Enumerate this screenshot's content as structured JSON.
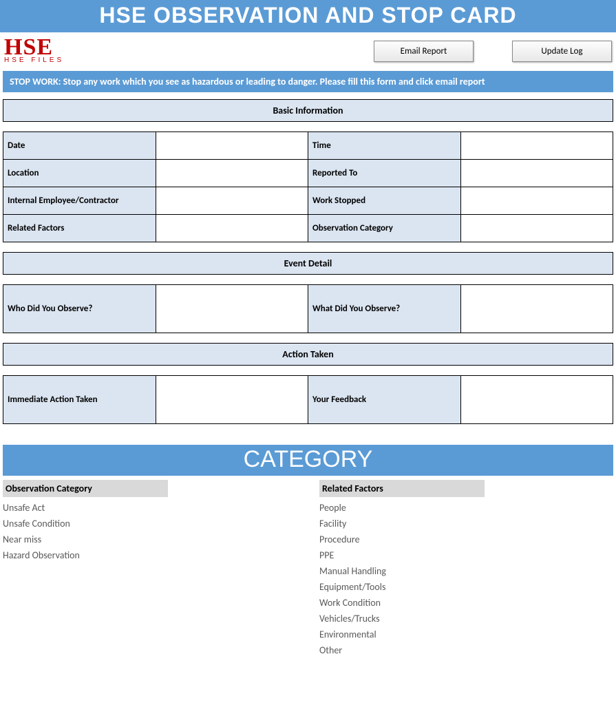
{
  "title": "HSE OBSERVATION AND STOP CARD",
  "logo": {
    "big": "HSE",
    "small": "HSE FILES"
  },
  "buttons": {
    "email": "Email Report",
    "update": "Update Log"
  },
  "notice": "STOP WORK: Stop any work which you see as hazardous or leading to danger.  Please fill this form and click email report",
  "sections": {
    "basic": {
      "heading": "Basic Information",
      "rows": [
        {
          "l1": "Date",
          "v1": "",
          "l2": "Time",
          "v2": ""
        },
        {
          "l1": "Location",
          "v1": "",
          "l2": "Reported To",
          "v2": ""
        },
        {
          "l1": "Internal Employee/Contractor",
          "v1": "",
          "l2": "Work Stopped",
          "v2": ""
        },
        {
          "l1": "Related Factors",
          "v1": "",
          "l2": "Observation Category",
          "v2": ""
        }
      ]
    },
    "event": {
      "heading": "Event Detail",
      "rows": [
        {
          "l1": "Who Did You Observe?",
          "v1": "",
          "l2": "What Did You Observe?",
          "v2": ""
        }
      ]
    },
    "action": {
      "heading": "Action Taken",
      "rows": [
        {
          "l1": "Immediate Action Taken",
          "v1": "",
          "l2": "Your Feedback",
          "v2": ""
        }
      ]
    }
  },
  "categoryTitle": "CATEGORY",
  "categories": {
    "observation": {
      "heading": "Observation Category",
      "items": [
        "Unsafe Act",
        "Unsafe Condition",
        "Near miss",
        "Hazard Observation"
      ]
    },
    "related": {
      "heading": "Related Factors",
      "items": [
        "People",
        "Facility",
        "Procedure",
        "PPE",
        "Manual Handling",
        "Equipment/Tools",
        "Work Condition",
        "Vehicles/Trucks",
        "Environmental",
        "Other"
      ]
    }
  }
}
